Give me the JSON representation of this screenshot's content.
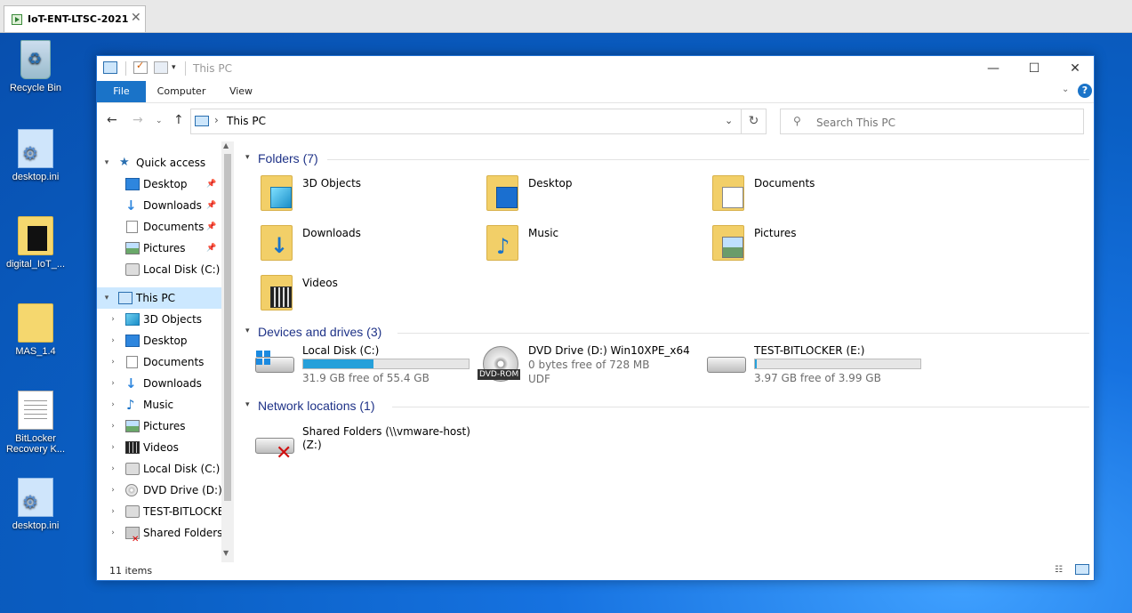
{
  "vm_tab": {
    "label": "IoT-ENT-LTSC-2021",
    "close": "✕"
  },
  "desktop_icons": [
    {
      "label": "Recycle Bin"
    },
    {
      "label": "desktop.ini"
    },
    {
      "label": "digital_IoT_..."
    },
    {
      "label": "MAS_1.4"
    },
    {
      "label": "BitLocker Recovery K..."
    },
    {
      "label": "desktop.ini"
    }
  ],
  "window": {
    "title": "This PC",
    "minimize": "—",
    "maximize": "☐",
    "close": "✕",
    "qat_dropdown": "▾"
  },
  "ribbon": {
    "tabs": [
      {
        "label": "File"
      },
      {
        "label": "Computer"
      },
      {
        "label": "View"
      }
    ],
    "expand": "⌄",
    "help": "?"
  },
  "navbar": {
    "back": "←",
    "forward": "→",
    "recent": "⌄",
    "up": "↑",
    "address_sep": "›",
    "address": "This PC",
    "address_dropdown": "⌄",
    "refresh": "↻",
    "search_icon": "⚲",
    "search_placeholder": "Search This PC"
  },
  "nav_pane": {
    "quick_access": "Quick access",
    "pin": "📌",
    "quick_items": [
      {
        "label": "Desktop",
        "pinned": true
      },
      {
        "label": "Downloads",
        "pinned": true
      },
      {
        "label": "Documents",
        "pinned": true
      },
      {
        "label": "Pictures",
        "pinned": true
      },
      {
        "label": "Local Disk (C:)",
        "pinned": false
      }
    ],
    "this_pc": "This PC",
    "pc_items": [
      {
        "label": "3D Objects"
      },
      {
        "label": "Desktop"
      },
      {
        "label": "Documents"
      },
      {
        "label": "Downloads"
      },
      {
        "label": "Music"
      },
      {
        "label": "Pictures"
      },
      {
        "label": "Videos"
      },
      {
        "label": "Local Disk (C:)"
      },
      {
        "label": "DVD Drive (D:) W"
      },
      {
        "label": "TEST-BITLOCKER"
      },
      {
        "label": "Shared Folders (\\"
      }
    ],
    "expanded_chev": "▾",
    "collapsed_chev": "›",
    "scroll_up": "▲",
    "scroll_down": "▼"
  },
  "groups": {
    "folders": "Folders (7)",
    "devices": "Devices and drives (3)",
    "network": "Network locations (1)",
    "chev": "▾"
  },
  "folders": [
    {
      "label": "3D Objects"
    },
    {
      "label": "Desktop"
    },
    {
      "label": "Documents"
    },
    {
      "label": "Downloads"
    },
    {
      "label": "Music"
    },
    {
      "label": "Pictures"
    },
    {
      "label": "Videos"
    }
  ],
  "drives": [
    {
      "name": "Local Disk (C:)",
      "free": "31.9 GB free of 55.4 GB",
      "used_fraction": 0.424
    },
    {
      "name": "DVD Drive (D:) Win10XPE_x64",
      "free": "0 bytes free of 728 MB",
      "fs": "UDF",
      "badge": "DVD-ROM"
    },
    {
      "name": "TEST-BITLOCKER (E:)",
      "free": "3.97 GB free of 3.99 GB",
      "used_fraction": 0.005
    }
  ],
  "network": [
    {
      "line1": "Shared Folders (\\\\vmware-host)",
      "line2": "(Z:)"
    }
  ],
  "status": {
    "count": "11 items"
  },
  "colors": {
    "accent": "#1a73c8",
    "selection": "#cce8ff",
    "bar_fill": "#26a0da",
    "group_title": "#1e3287"
  },
  "icons": {
    "recycle": "recycle-bin-icon",
    "pc": "this-pc-icon",
    "folder": "folder-icon",
    "drive": "hard-drive-icon",
    "dvd": "dvd-icon",
    "network_drive": "disconnected-network-drive-icon"
  }
}
